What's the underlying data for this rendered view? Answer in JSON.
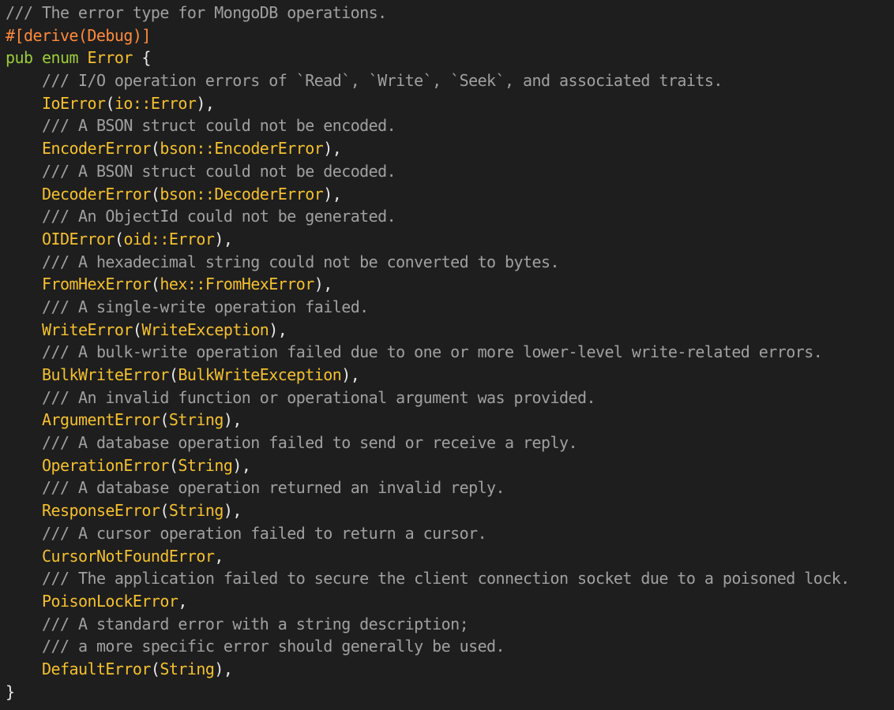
{
  "editor": {
    "colors": {
      "background": "#1e1e1e",
      "comment": "#a0a0a0",
      "attribute": "#ff8a3c",
      "keyword": "#9ccc3a",
      "type": "#f5c02e",
      "plain": "#e8e8e8"
    },
    "lines": [
      [
        {
          "k": "comment",
          "t": "/// The error type for MongoDB operations."
        }
      ],
      [
        {
          "k": "attr",
          "t": "#[derive(Debug)]"
        }
      ],
      [
        {
          "k": "keyword",
          "t": "pub"
        },
        {
          "k": "plain",
          "t": " "
        },
        {
          "k": "keyword",
          "t": "enum"
        },
        {
          "k": "plain",
          "t": " "
        },
        {
          "k": "type",
          "t": "Error"
        },
        {
          "k": "plain",
          "t": " {"
        }
      ],
      [
        {
          "k": "comment",
          "t": "/// I/O operation errors of `Read`, `Write`, `Seek`, and associated traits."
        }
      ],
      [
        {
          "k": "type",
          "t": "IoError"
        },
        {
          "k": "plain",
          "t": "("
        },
        {
          "k": "type",
          "t": "io::Error"
        },
        {
          "k": "plain",
          "t": "),"
        }
      ],
      [
        {
          "k": "comment",
          "t": "/// A BSON struct could not be encoded."
        }
      ],
      [
        {
          "k": "type",
          "t": "EncoderError"
        },
        {
          "k": "plain",
          "t": "("
        },
        {
          "k": "type",
          "t": "bson::EncoderError"
        },
        {
          "k": "plain",
          "t": "),"
        }
      ],
      [
        {
          "k": "comment",
          "t": "/// A BSON struct could not be decoded."
        }
      ],
      [
        {
          "k": "type",
          "t": "DecoderError"
        },
        {
          "k": "plain",
          "t": "("
        },
        {
          "k": "type",
          "t": "bson::DecoderError"
        },
        {
          "k": "plain",
          "t": "),"
        }
      ],
      [
        {
          "k": "comment",
          "t": "/// An ObjectId could not be generated."
        }
      ],
      [
        {
          "k": "type",
          "t": "OIDError"
        },
        {
          "k": "plain",
          "t": "("
        },
        {
          "k": "type",
          "t": "oid::Error"
        },
        {
          "k": "plain",
          "t": "),"
        }
      ],
      [
        {
          "k": "comment",
          "t": "/// A hexadecimal string could not be converted to bytes."
        }
      ],
      [
        {
          "k": "type",
          "t": "FromHexError"
        },
        {
          "k": "plain",
          "t": "("
        },
        {
          "k": "type",
          "t": "hex::FromHexError"
        },
        {
          "k": "plain",
          "t": "),"
        }
      ],
      [
        {
          "k": "comment",
          "t": "/// A single-write operation failed."
        }
      ],
      [
        {
          "k": "type",
          "t": "WriteError"
        },
        {
          "k": "plain",
          "t": "("
        },
        {
          "k": "type",
          "t": "WriteException"
        },
        {
          "k": "plain",
          "t": "),"
        }
      ],
      [
        {
          "k": "comment",
          "t": "/// A bulk-write operation failed due to one or more lower-level write-related errors."
        }
      ],
      [
        {
          "k": "type",
          "t": "BulkWriteError"
        },
        {
          "k": "plain",
          "t": "("
        },
        {
          "k": "type",
          "t": "BulkWriteException"
        },
        {
          "k": "plain",
          "t": "),"
        }
      ],
      [
        {
          "k": "comment",
          "t": "/// An invalid function or operational argument was provided."
        }
      ],
      [
        {
          "k": "type",
          "t": "ArgumentError"
        },
        {
          "k": "plain",
          "t": "("
        },
        {
          "k": "type",
          "t": "String"
        },
        {
          "k": "plain",
          "t": "),"
        }
      ],
      [
        {
          "k": "comment",
          "t": "/// A database operation failed to send or receive a reply."
        }
      ],
      [
        {
          "k": "type",
          "t": "OperationError"
        },
        {
          "k": "plain",
          "t": "("
        },
        {
          "k": "type",
          "t": "String"
        },
        {
          "k": "plain",
          "t": "),"
        }
      ],
      [
        {
          "k": "comment",
          "t": "/// A database operation returned an invalid reply."
        }
      ],
      [
        {
          "k": "type",
          "t": "ResponseError"
        },
        {
          "k": "plain",
          "t": "("
        },
        {
          "k": "type",
          "t": "String"
        },
        {
          "k": "plain",
          "t": "),"
        }
      ],
      [
        {
          "k": "comment",
          "t": "/// A cursor operation failed to return a cursor."
        }
      ],
      [
        {
          "k": "type",
          "t": "CursorNotFoundError"
        },
        {
          "k": "plain",
          "t": ","
        }
      ],
      [
        {
          "k": "comment",
          "t": "/// The application failed to secure the client connection socket due to a poisoned lock."
        }
      ],
      [
        {
          "k": "type",
          "t": "PoisonLockError"
        },
        {
          "k": "plain",
          "t": ","
        }
      ],
      [
        {
          "k": "comment",
          "t": "/// A standard error with a string description;"
        }
      ],
      [
        {
          "k": "comment",
          "t": "/// a more specific error should generally be used."
        }
      ],
      [
        {
          "k": "type",
          "t": "DefaultError"
        },
        {
          "k": "plain",
          "t": "("
        },
        {
          "k": "type",
          "t": "String"
        },
        {
          "k": "plain",
          "t": "),"
        }
      ],
      [
        {
          "k": "plain",
          "t": "}"
        }
      ]
    ]
  }
}
